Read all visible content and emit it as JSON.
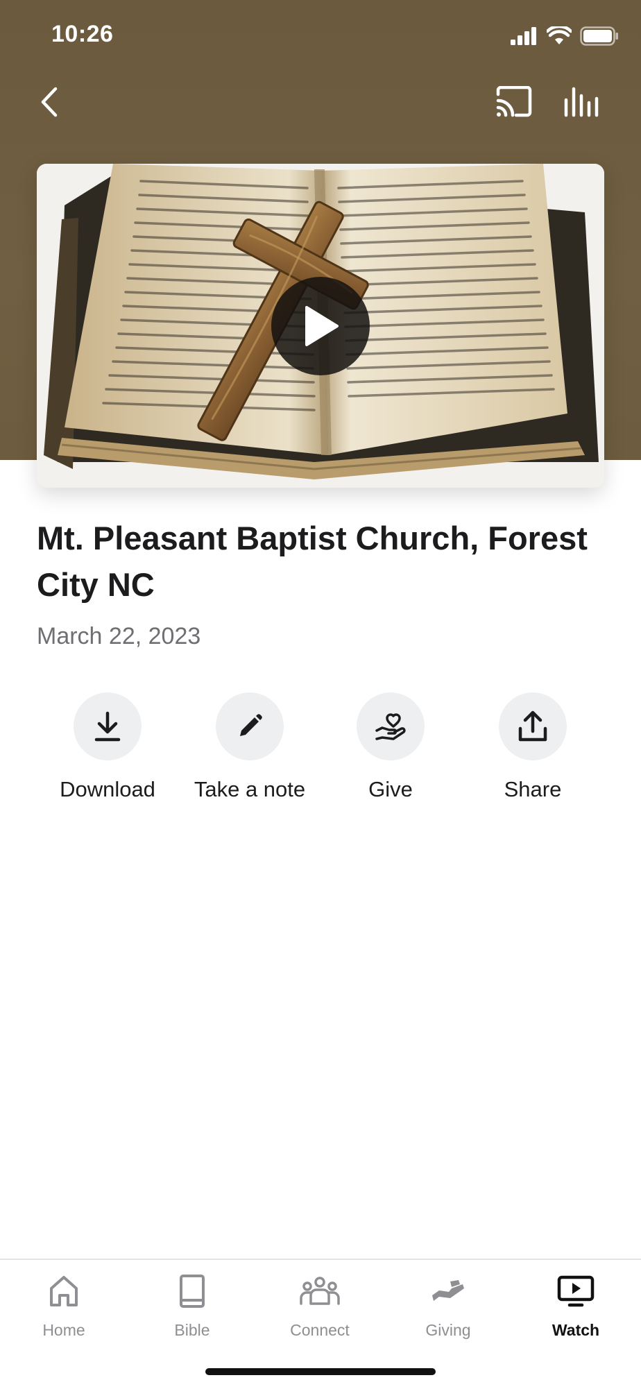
{
  "status_bar": {
    "time": "10:26"
  },
  "video": {
    "title": "Mt. Pleasant Baptist Church, Forest City NC",
    "date": "March 22, 2023"
  },
  "actions": [
    {
      "label": "Download",
      "icon": "download-icon"
    },
    {
      "label": "Take a note",
      "icon": "pencil-icon"
    },
    {
      "label": "Give",
      "icon": "heart-hand-icon"
    },
    {
      "label": "Share",
      "icon": "share-icon"
    }
  ],
  "tabs": [
    {
      "label": "Home",
      "icon": "home-icon",
      "active": false
    },
    {
      "label": "Bible",
      "icon": "book-icon",
      "active": false
    },
    {
      "label": "Connect",
      "icon": "people-icon",
      "active": false
    },
    {
      "label": "Giving",
      "icon": "giving-hand-icon",
      "active": false
    },
    {
      "label": "Watch",
      "icon": "tv-play-icon",
      "active": true
    }
  ],
  "colors": {
    "header": "#6e5d40",
    "action_circle": "#eeeff1",
    "tab_inactive": "#8e8e93",
    "tab_active": "#111111"
  }
}
